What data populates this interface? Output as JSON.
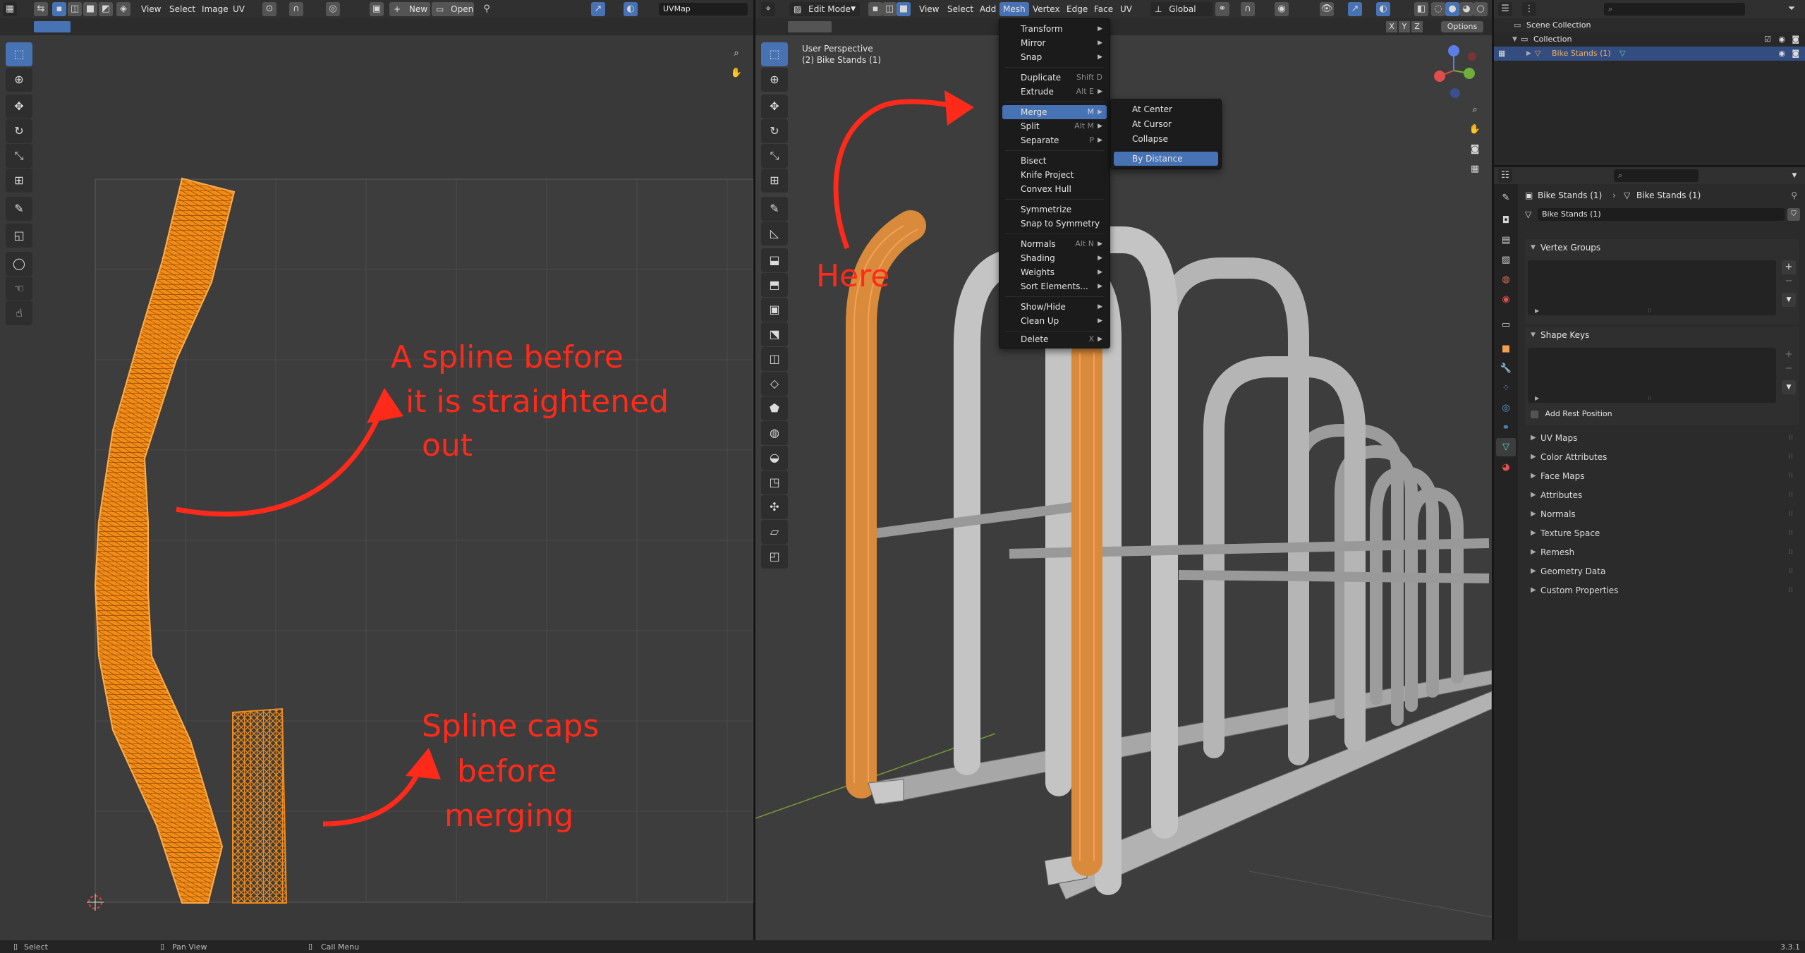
{
  "uv_editor": {
    "menus": [
      "View",
      "Select",
      "Image",
      "UV"
    ],
    "new_label": "New",
    "open_label": "Open",
    "uvmap_field": "UVMap",
    "annotations": {
      "spline_line1": "A spline before",
      "spline_line2": "it is straightened",
      "spline_line3": "out",
      "caps_line1": "Spline caps",
      "caps_line2": "before",
      "caps_line3": "merging"
    }
  },
  "viewport": {
    "mode": "Edit Mode",
    "menus": [
      "View",
      "Select",
      "Add",
      "Mesh",
      "Vertex",
      "Edge",
      "Face",
      "UV"
    ],
    "transform_orientation": "Global",
    "axis_labels": [
      "X",
      "Y",
      "Z"
    ],
    "options_label": "Options",
    "perspective_label": "User Perspective",
    "object_label": "(2) Bike Stands (1)",
    "annotation_here": "Here"
  },
  "mesh_menu": {
    "items": [
      {
        "label": "Transform",
        "shortcut": "",
        "submenu": true
      },
      {
        "label": "Mirror",
        "shortcut": "",
        "submenu": true
      },
      {
        "label": "Snap",
        "shortcut": "",
        "submenu": true
      },
      {
        "label": "Duplicate",
        "shortcut": "Shift D",
        "submenu": false
      },
      {
        "label": "Extrude",
        "shortcut": "Alt E",
        "submenu": true
      },
      {
        "label": "Merge",
        "shortcut": "M",
        "submenu": true
      },
      {
        "label": "Split",
        "shortcut": "Alt M",
        "submenu": true
      },
      {
        "label": "Separate",
        "shortcut": "P",
        "submenu": true
      },
      {
        "label": "Bisect",
        "shortcut": "",
        "submenu": false
      },
      {
        "label": "Knife Project",
        "shortcut": "",
        "submenu": false
      },
      {
        "label": "Convex Hull",
        "shortcut": "",
        "submenu": false
      },
      {
        "label": "Symmetrize",
        "shortcut": "",
        "submenu": false
      },
      {
        "label": "Snap to Symmetry",
        "shortcut": "",
        "submenu": false
      },
      {
        "label": "Normals",
        "shortcut": "Alt N",
        "submenu": true
      },
      {
        "label": "Shading",
        "shortcut": "",
        "submenu": true
      },
      {
        "label": "Weights",
        "shortcut": "",
        "submenu": true
      },
      {
        "label": "Sort Elements...",
        "shortcut": "",
        "submenu": true
      },
      {
        "label": "Show/Hide",
        "shortcut": "",
        "submenu": true
      },
      {
        "label": "Clean Up",
        "shortcut": "",
        "submenu": true
      },
      {
        "label": "Delete",
        "shortcut": "X",
        "submenu": true
      }
    ],
    "highlighted": "Merge"
  },
  "merge_submenu": {
    "items": [
      "At Center",
      "At Cursor",
      "Collapse",
      "By Distance"
    ],
    "highlighted": "By Distance"
  },
  "outliner": {
    "scene_collection": "Scene Collection",
    "collection": "Collection",
    "object": "Bike Stands (1)"
  },
  "properties": {
    "breadcrumb_object": "Bike Stands (1)",
    "breadcrumb_data": "Bike Stands (1)",
    "mesh_name": "Bike Stands (1)",
    "vertex_groups": "Vertex Groups",
    "shape_keys": "Shape Keys",
    "add_rest_position": "Add Rest Position",
    "panels": [
      "UV Maps",
      "Color Attributes",
      "Face Maps",
      "Attributes",
      "Normals",
      "Texture Space",
      "Remesh",
      "Geometry Data",
      "Custom Properties"
    ]
  },
  "status_bar": {
    "select": "Select",
    "pan_view": "Pan View",
    "call_menu": "Call Menu",
    "version": "3.3.1"
  },
  "colors": {
    "accent": "#4772b3",
    "annotation": "#ff2a1a",
    "selected_mesh": "#f28c18"
  }
}
